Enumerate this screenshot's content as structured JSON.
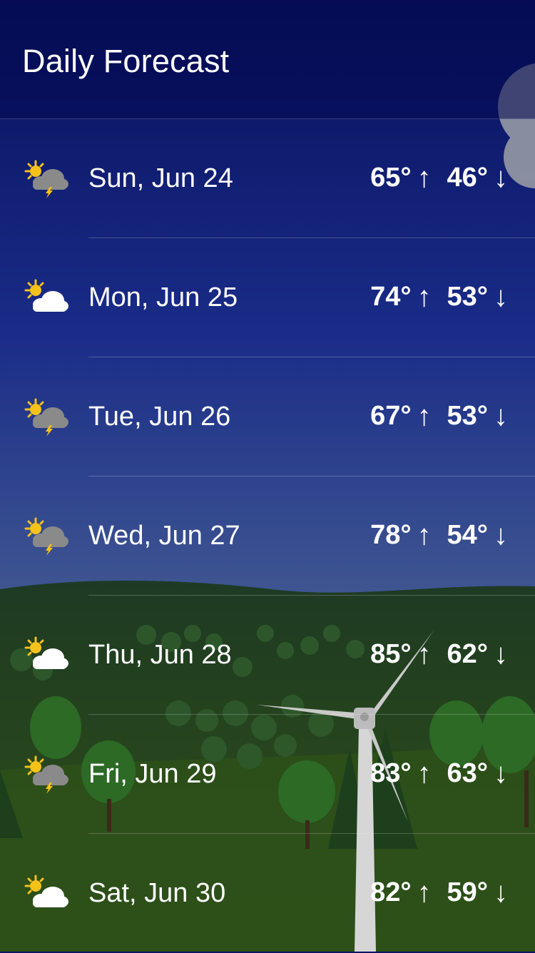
{
  "header": {
    "title": "Daily Forecast"
  },
  "forecast": [
    {
      "icon": "partly-cloudy-thunderstorm-icon",
      "date": "Sun, Jun 24",
      "high": "65°",
      "low": "46°"
    },
    {
      "icon": "partly-cloudy-icon",
      "date": "Mon, Jun 25",
      "high": "74°",
      "low": "53°"
    },
    {
      "icon": "partly-cloudy-thunderstorm-icon",
      "date": "Tue, Jun 26",
      "high": "67°",
      "low": "53°"
    },
    {
      "icon": "partly-cloudy-thunderstorm-icon",
      "date": "Wed, Jun 27",
      "high": "78°",
      "low": "54°"
    },
    {
      "icon": "partly-cloudy-icon",
      "date": "Thu, Jun 28",
      "high": "85°",
      "low": "62°"
    },
    {
      "icon": "partly-cloudy-thunderstorm-icon",
      "date": "Fri, Jun 29",
      "high": "83°",
      "low": "63°"
    },
    {
      "icon": "partly-cloudy-icon",
      "date": "Sat, Jun 30",
      "high": "82°",
      "low": "59°"
    }
  ],
  "arrows": {
    "up": "↑",
    "down": "↓"
  },
  "colors": {
    "sky_top": "#07105c",
    "sky_bottom": "#3e5591",
    "hills": "#1f3a1e",
    "grass": "#2b4a1c",
    "sun": "#f5c21a",
    "storm_cloud": "#8a8a8a"
  }
}
